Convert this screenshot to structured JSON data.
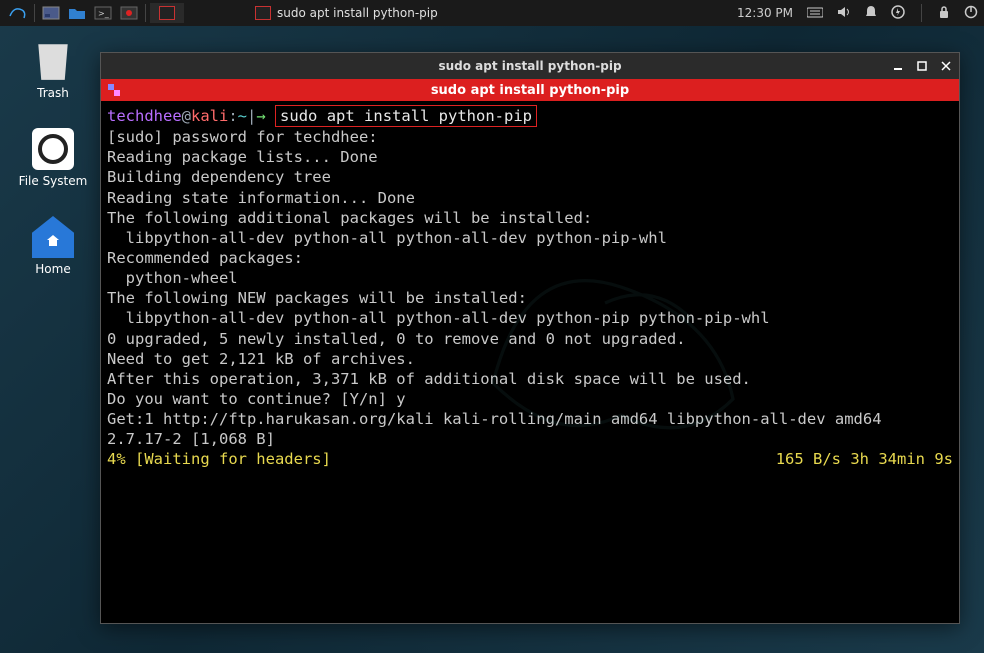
{
  "panel": {
    "time": "12:30 PM",
    "task_title": "sudo apt install python-pip"
  },
  "desktop": {
    "trash": "Trash",
    "filesystem": "File System",
    "home": "Home"
  },
  "window": {
    "title": "sudo apt install python-pip",
    "tab_title": "sudo apt install python-pip"
  },
  "prompt": {
    "user": "techdhee",
    "at": "@",
    "host": "kali",
    "colon": ":",
    "path": "~",
    "sep": "|",
    "arrow": "→",
    "command": "sudo apt install python-pip"
  },
  "output": {
    "l1": "[sudo] password for techdhee:",
    "l2": "Reading package lists... Done",
    "l3": "Building dependency tree",
    "l4": "Reading state information... Done",
    "l5": "The following additional packages will be installed:",
    "l6": "libpython-all-dev python-all python-all-dev python-pip-whl",
    "l7": "Recommended packages:",
    "l8": "python-wheel",
    "l9": "The following NEW packages will be installed:",
    "l10": "libpython-all-dev python-all python-all-dev python-pip python-pip-whl",
    "l11": "0 upgraded, 5 newly installed, 0 to remove and 0 not upgraded.",
    "l12": "Need to get 2,121 kB of archives.",
    "l13": "After this operation, 3,371 kB of additional disk space will be used.",
    "l14": "Do you want to continue? [Y/n] y",
    "l15": "Get:1 http://ftp.harukasan.org/kali kali-rolling/main amd64 libpython-all-dev amd64 2.7.17-2 [1,068 B]",
    "progress_left": "4% [Waiting for headers]",
    "progress_right": "165 B/s 3h 34min 9s"
  }
}
